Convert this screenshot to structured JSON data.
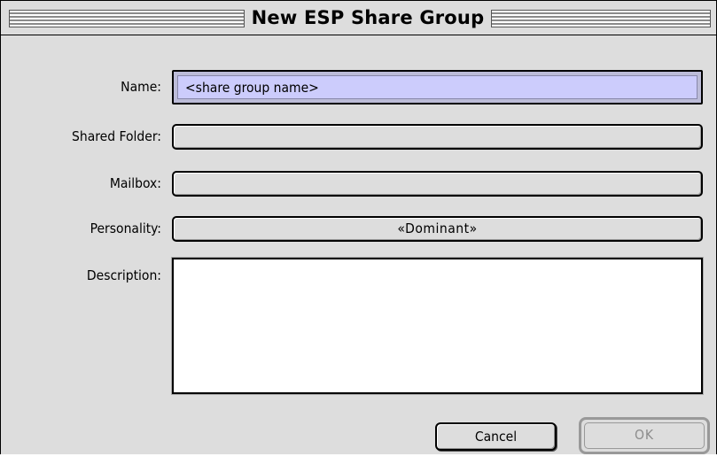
{
  "window": {
    "title": "New ESP Share Group"
  },
  "form": {
    "name_label": "Name:",
    "name_value": "<share group name>",
    "shared_folder_label": "Shared Folder:",
    "shared_folder_value": "",
    "mailbox_label": "Mailbox:",
    "mailbox_value": "",
    "personality_label": "Personality:",
    "personality_value": "«Dominant»",
    "description_label": "Description:",
    "description_value": ""
  },
  "buttons": {
    "cancel_label": "Cancel",
    "ok_label": "OK",
    "ok_enabled": false
  },
  "colors": {
    "window_background": "#dddddd",
    "name_field_highlight": "#ccccfc",
    "disabled_text": "#8c8c8c"
  }
}
